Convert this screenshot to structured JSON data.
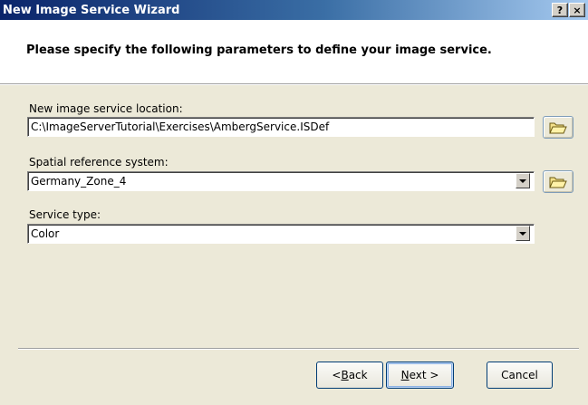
{
  "window": {
    "title": "New Image Service Wizard",
    "help_button": "?",
    "close_button": "×"
  },
  "header": {
    "instruction": "Please specify the following parameters to define your image service."
  },
  "fields": {
    "location": {
      "label": "New image service location:",
      "value": "C:\\ImageServerTutorial\\Exercises\\AmbergService.ISDef"
    },
    "spatial_reference": {
      "label": "Spatial reference system:",
      "value": "Germany_Zone_4"
    },
    "service_type": {
      "label": "Service type:",
      "value": "Color"
    }
  },
  "buttons": {
    "back_prefix": "< ",
    "back_mnemonic": "B",
    "back_rest": "ack",
    "next_mnemonic": "N",
    "next_rest": "ext >",
    "cancel": "Cancel"
  },
  "icons": {
    "browse_location": "folder-open-icon",
    "browse_spatial": "folder-open-icon",
    "dropdown": "chevron-down-icon"
  },
  "colors": {
    "titlebar_start": "#0a246a",
    "titlebar_end": "#a6caf0",
    "dialog_bg": "#ece9d8",
    "default_button_border": "#003c74"
  }
}
